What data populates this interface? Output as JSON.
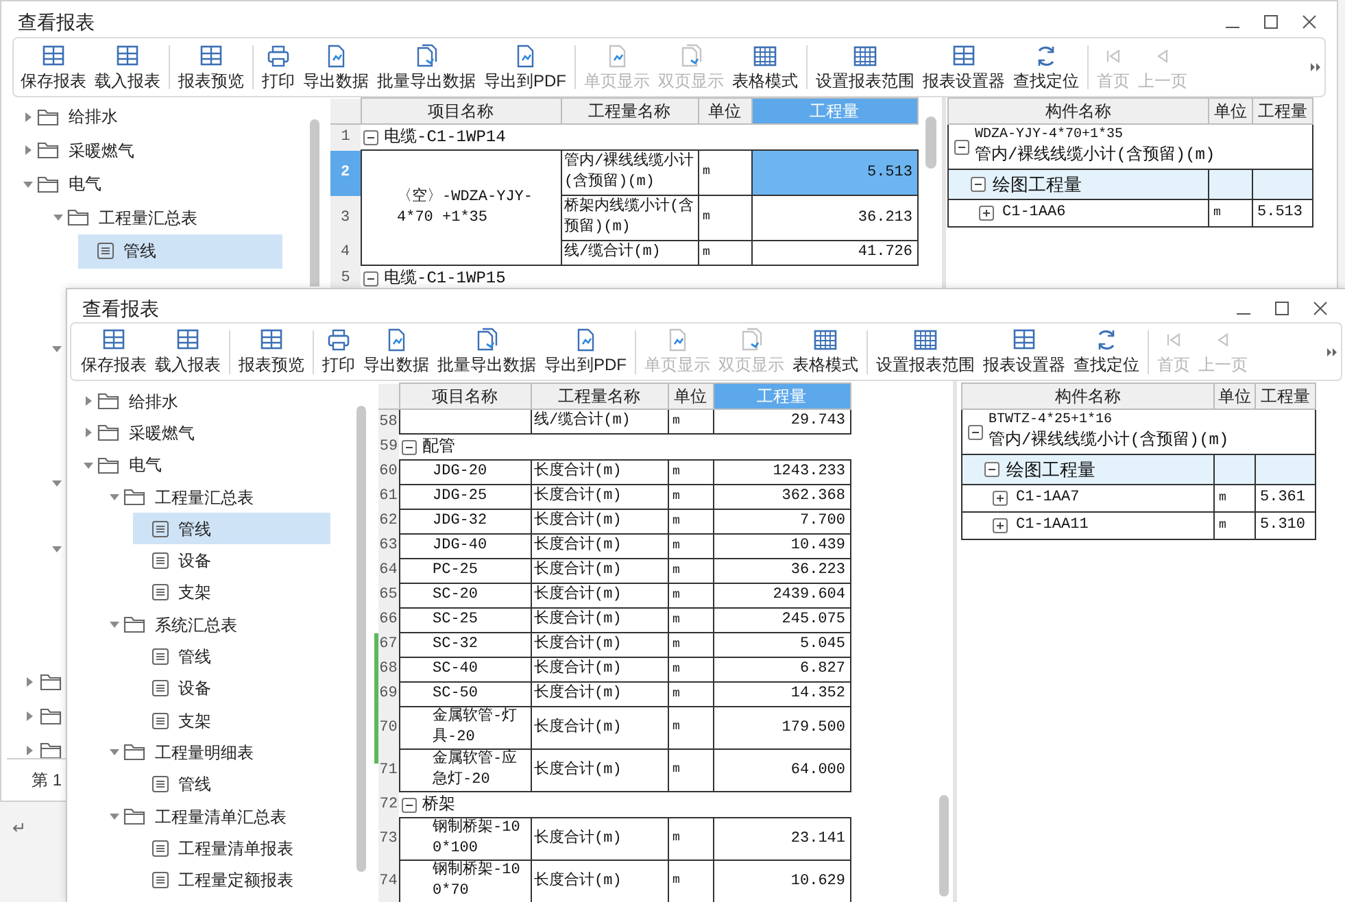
{
  "back_window": {
    "title": "查看报表",
    "toolbar": [
      {
        "label": "保存报表",
        "disabled": false,
        "separator_before": false
      },
      {
        "label": "载入报表",
        "disabled": false,
        "separator_before": false
      },
      {
        "label": "报表预览",
        "disabled": false,
        "separator_before": true
      },
      {
        "label": "打印",
        "disabled": false,
        "separator_before": true
      },
      {
        "label": "导出数据",
        "disabled": false,
        "separator_before": false
      },
      {
        "label": "批量导出数据",
        "disabled": false,
        "separator_before": false
      },
      {
        "label": "导出到PDF",
        "disabled": false,
        "separator_before": false
      },
      {
        "label": "单页显示",
        "disabled": true,
        "separator_before": true
      },
      {
        "label": "双页显示",
        "disabled": true,
        "separator_before": false
      },
      {
        "label": "表格模式",
        "disabled": false,
        "separator_before": false
      },
      {
        "label": "设置报表范围",
        "disabled": false,
        "separator_before": true
      },
      {
        "label": "报表设置器",
        "disabled": false,
        "separator_before": false
      },
      {
        "label": "查找定位",
        "disabled": false,
        "separator_before": false
      },
      {
        "label": "首页",
        "disabled": true,
        "separator_before": true
      },
      {
        "label": "上一页",
        "disabled": true,
        "separator_before": false
      }
    ],
    "tree": [
      {
        "label": "给排水",
        "kind": "folder",
        "expanded": false,
        "selected": false
      },
      {
        "label": "采暖燃气",
        "kind": "folder",
        "expanded": false,
        "selected": false
      },
      {
        "label": "电气",
        "kind": "folder",
        "expanded": true,
        "selected": false,
        "children": [
          {
            "label": "工程量汇总表",
            "kind": "folder",
            "expanded": true,
            "selected": false,
            "children": [
              {
                "label": "管线",
                "kind": "report",
                "selected": true
              }
            ]
          }
        ]
      }
    ],
    "report_table": {
      "columns": [
        {
          "label": "项目名称",
          "selected": false
        },
        {
          "label": "工程量名称",
          "selected": false
        },
        {
          "label": "单位",
          "selected": false
        },
        {
          "label": "工程量",
          "selected": true
        }
      ],
      "rows": [
        {
          "kind": "group",
          "number": "1",
          "label": "电缆-C1-1WP14",
          "expanded": true
        },
        {
          "kind": "merged",
          "name": "〈空〉-WDZA-YJY-4*70 +1*35",
          "lines": [
            {
              "number": "2",
              "selected": true,
              "quantity_name": "管内/裸线线缆小计(含预留)(m)",
              "unit": "m",
              "value": "5.513"
            },
            {
              "number": "3",
              "selected": false,
              "quantity_name": "桥架内线缆小计(含预留)(m)",
              "unit": "m",
              "value": "36.213"
            },
            {
              "number": "4",
              "selected": false,
              "quantity_name": "线/缆合计(m)",
              "unit": "m",
              "value": "41.726"
            }
          ]
        },
        {
          "kind": "group",
          "number": "5",
          "label": "电缆-C1-1WP15",
          "expanded": true
        }
      ]
    },
    "detail": {
      "columns": [
        "构件名称",
        "单位",
        "工程量"
      ],
      "group": {
        "code": "WDZA-YJY-4*70+1*35",
        "quantity_name": "管内/裸线线缆小计(含预留)(m)",
        "expanded": true
      },
      "subgroup": {
        "label": "绘图工程量",
        "expanded": true
      },
      "items": [
        {
          "label": "C1-1AA6",
          "unit": "m",
          "value": "5.513",
          "expanded": false
        }
      ]
    },
    "left_panel_footer": "第 1"
  },
  "front_window": {
    "title": "查看报表",
    "toolbar": [
      {
        "label": "保存报表",
        "disabled": false,
        "separator_before": false
      },
      {
        "label": "载入报表",
        "disabled": false,
        "separator_before": false
      },
      {
        "label": "报表预览",
        "disabled": false,
        "separator_before": true
      },
      {
        "label": "打印",
        "disabled": false,
        "separator_before": true
      },
      {
        "label": "导出数据",
        "disabled": false,
        "separator_before": false
      },
      {
        "label": "批量导出数据",
        "disabled": false,
        "separator_before": false
      },
      {
        "label": "导出到PDF",
        "disabled": false,
        "separator_before": false
      },
      {
        "label": "单页显示",
        "disabled": true,
        "separator_before": true
      },
      {
        "label": "双页显示",
        "disabled": true,
        "separator_before": false
      },
      {
        "label": "表格模式",
        "disabled": false,
        "separator_before": false
      },
      {
        "label": "设置报表范围",
        "disabled": false,
        "separator_before": true
      },
      {
        "label": "报表设置器",
        "disabled": false,
        "separator_before": false
      },
      {
        "label": "查找定位",
        "disabled": false,
        "separator_before": false
      },
      {
        "label": "首页",
        "disabled": true,
        "separator_before": true
      },
      {
        "label": "上一页",
        "disabled": true,
        "separator_before": false
      }
    ],
    "tree": [
      {
        "label": "给排水",
        "kind": "folder",
        "expanded": false,
        "selected": false
      },
      {
        "label": "采暖燃气",
        "kind": "folder",
        "expanded": false,
        "selected": false
      },
      {
        "label": "电气",
        "kind": "folder",
        "expanded": true,
        "selected": false,
        "children": [
          {
            "label": "工程量汇总表",
            "kind": "folder",
            "expanded": true,
            "selected": false,
            "children": [
              {
                "label": "管线",
                "kind": "report",
                "selected": true
              },
              {
                "label": "设备",
                "kind": "report",
                "selected": false
              },
              {
                "label": "支架",
                "kind": "report",
                "selected": false
              }
            ]
          },
          {
            "label": "系统汇总表",
            "kind": "folder",
            "expanded": true,
            "selected": false,
            "children": [
              {
                "label": "管线",
                "kind": "report",
                "selected": false
              },
              {
                "label": "设备",
                "kind": "report",
                "selected": false
              },
              {
                "label": "支架",
                "kind": "report",
                "selected": false
              }
            ]
          },
          {
            "label": "工程量明细表",
            "kind": "folder",
            "expanded": true,
            "selected": false,
            "children": [
              {
                "label": "管线",
                "kind": "report",
                "selected": false
              }
            ]
          },
          {
            "label": "工程量清单汇总表",
            "kind": "folder",
            "expanded": true,
            "selected": false,
            "children": [
              {
                "label": "工程量清单报表",
                "kind": "report",
                "selected": false
              },
              {
                "label": "工程量定额报表",
                "kind": "report",
                "selected": false
              }
            ]
          }
        ]
      }
    ],
    "report_table": {
      "columns": [
        {
          "label": "项目名称",
          "selected": false
        },
        {
          "label": "工程量名称",
          "selected": false
        },
        {
          "label": "单位",
          "selected": false
        },
        {
          "label": "工程量",
          "selected": true
        }
      ],
      "rows": [
        {
          "kind": "item",
          "number": "58",
          "quantity_name": "线/缆合计(m)",
          "unit": "m",
          "value": "29.743",
          "selected": false
        },
        {
          "kind": "group",
          "number": "59",
          "label": "配管",
          "expanded": true
        },
        {
          "kind": "item",
          "number": "60",
          "name": "JDG-20",
          "quantity_name": "长度合计(m)",
          "unit": "m",
          "value": "1243.233",
          "selected": false
        },
        {
          "kind": "item",
          "number": "61",
          "name": "JDG-25",
          "quantity_name": "长度合计(m)",
          "unit": "m",
          "value": "362.368",
          "selected": false
        },
        {
          "kind": "item",
          "number": "62",
          "name": "JDG-32",
          "quantity_name": "长度合计(m)",
          "unit": "m",
          "value": "7.700",
          "selected": false
        },
        {
          "kind": "item",
          "number": "63",
          "name": "JDG-40",
          "quantity_name": "长度合计(m)",
          "unit": "m",
          "value": "10.439",
          "selected": false
        },
        {
          "kind": "item",
          "number": "64",
          "name": "PC-25",
          "quantity_name": "长度合计(m)",
          "unit": "m",
          "value": "36.223",
          "selected": false
        },
        {
          "kind": "item",
          "number": "65",
          "name": "SC-20",
          "quantity_name": "长度合计(m)",
          "unit": "m",
          "value": "2439.604",
          "selected": false
        },
        {
          "kind": "item",
          "number": "66",
          "name": "SC-25",
          "quantity_name": "长度合计(m)",
          "unit": "m",
          "value": "245.075",
          "selected": false
        },
        {
          "kind": "item",
          "number": "67",
          "name": "SC-32",
          "quantity_name": "长度合计(m)",
          "unit": "m",
          "value": "5.045",
          "selected": false
        },
        {
          "kind": "item",
          "number": "68",
          "name": "SC-40",
          "quantity_name": "长度合计(m)",
          "unit": "m",
          "value": "6.827",
          "selected": false
        },
        {
          "kind": "item",
          "number": "69",
          "name": "SC-50",
          "quantity_name": "长度合计(m)",
          "unit": "m",
          "value": "14.352",
          "selected": false
        },
        {
          "kind": "item",
          "number": "70",
          "name": "金属软管-灯具-20",
          "quantity_name": "长度合计(m)",
          "unit": "m",
          "value": "179.500",
          "selected": false
        },
        {
          "kind": "item",
          "number": "71",
          "name": "金属软管-应急灯-20",
          "quantity_name": "长度合计(m)",
          "unit": "m",
          "value": "64.000",
          "selected": false
        },
        {
          "kind": "group",
          "number": "72",
          "label": "桥架",
          "expanded": true
        },
        {
          "kind": "item",
          "number": "73",
          "name": "钢制桥架-100*100",
          "quantity_name": "长度合计(m)",
          "unit": "m",
          "value": "23.141",
          "selected": false
        },
        {
          "kind": "item",
          "number": "74",
          "name": "钢制桥架-100*70",
          "quantity_name": "长度合计(m)",
          "unit": "m",
          "value": "10.629",
          "selected": false
        }
      ]
    },
    "detail": {
      "columns": [
        "构件名称",
        "单位",
        "工程量"
      ],
      "group": {
        "code": "BTWTZ-4*25+1*16",
        "quantity_name": "管内/裸线线缆小计(含预留)(m)",
        "expanded": true
      },
      "subgroup": {
        "label": "绘图工程量",
        "expanded": true
      },
      "items": [
        {
          "label": "C1-1AA7",
          "unit": "m",
          "value": "5.361",
          "expanded": false
        },
        {
          "label": "C1-1AA11",
          "unit": "m",
          "value": "5.310",
          "expanded": false
        }
      ]
    }
  },
  "document_mark": "↵"
}
